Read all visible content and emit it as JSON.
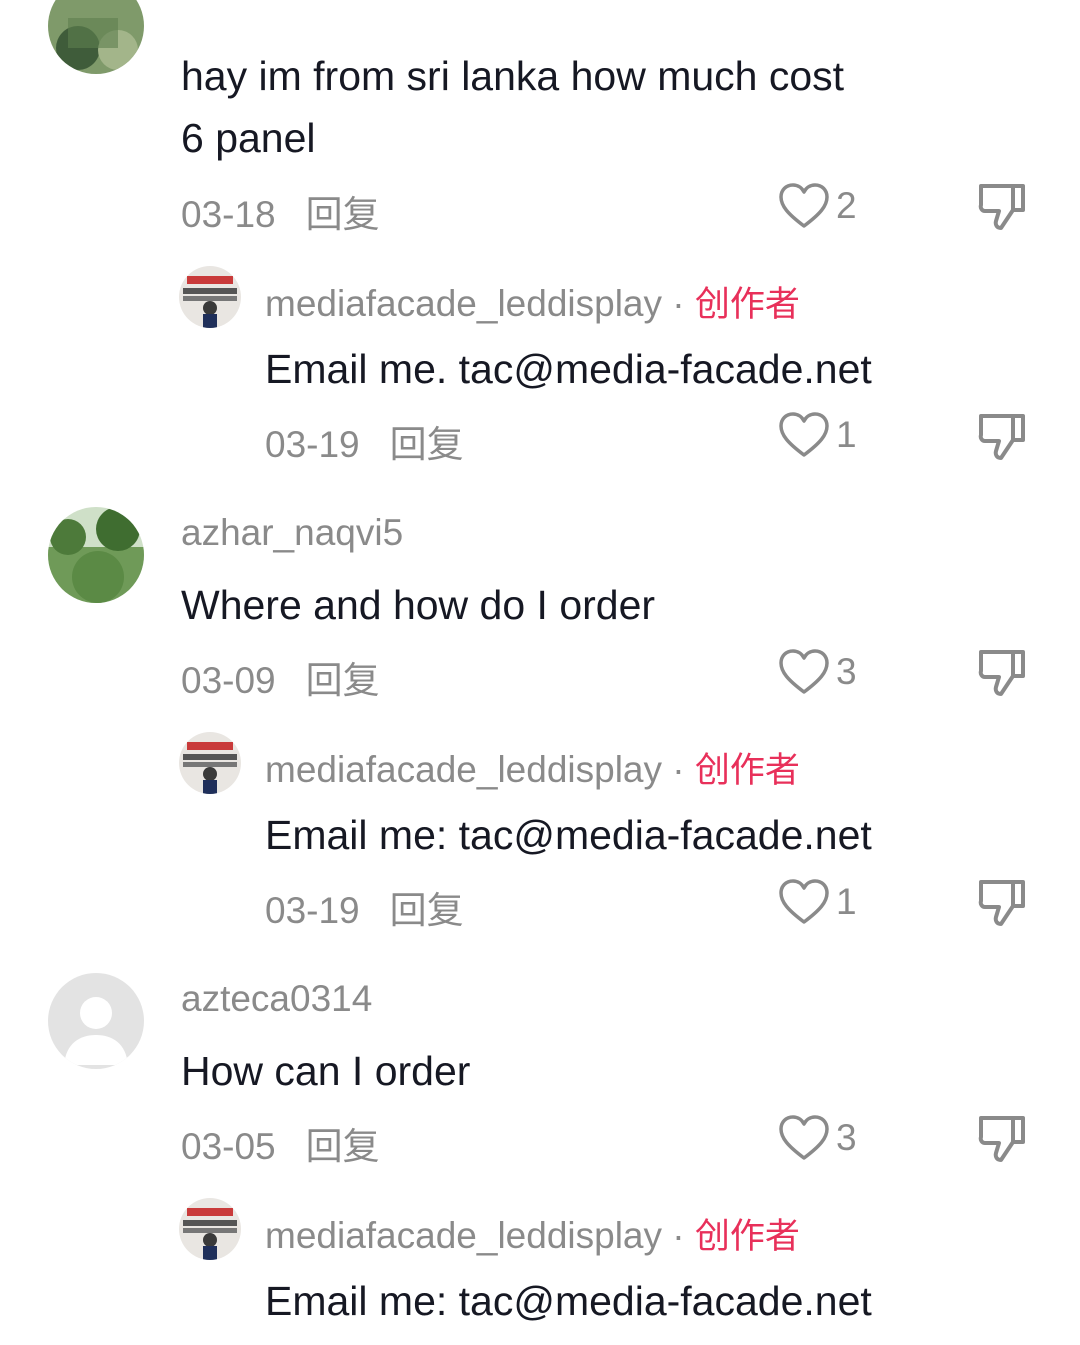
{
  "comments": [
    {
      "username": "",
      "text_lines": [
        "hay im from sri lanka how much cost",
        "6 panel"
      ],
      "date": "03-18",
      "reply_label": "回复",
      "likes": "2",
      "avatar": "landscape-photo-avatar",
      "reply": {
        "username": "mediafacade_leddisplay",
        "separator": "·",
        "creator_badge": "创作者",
        "text": "Email me. tac@media-facade.net",
        "date": "03-19",
        "reply_label": "回复",
        "likes": "1"
      }
    },
    {
      "username": "azhar_naqvi5",
      "text_lines": [
        "Where and how do I order"
      ],
      "date": "03-09",
      "reply_label": "回复",
      "likes": "3",
      "avatar": "tree-photo-avatar",
      "reply": {
        "username": "mediafacade_leddisplay",
        "separator": "·",
        "creator_badge": "创作者",
        "text": "Email me: tac@media-facade.net",
        "date": "03-19",
        "reply_label": "回复",
        "likes": "1"
      }
    },
    {
      "username": "azteca0314",
      "text_lines": [
        "How can I order"
      ],
      "date": "03-05",
      "reply_label": "回复",
      "likes": "3",
      "avatar": "default-avatar",
      "reply": {
        "username": "mediafacade_leddisplay",
        "separator": "·",
        "creator_badge": "创作者",
        "text": "Email me: tac@media-facade.net"
      }
    }
  ],
  "colors": {
    "text": "#161823",
    "muted": "#8a8a8a",
    "creator": "#e8305a"
  },
  "icons": [
    "heart-outline-icon",
    "dislike-icon"
  ]
}
